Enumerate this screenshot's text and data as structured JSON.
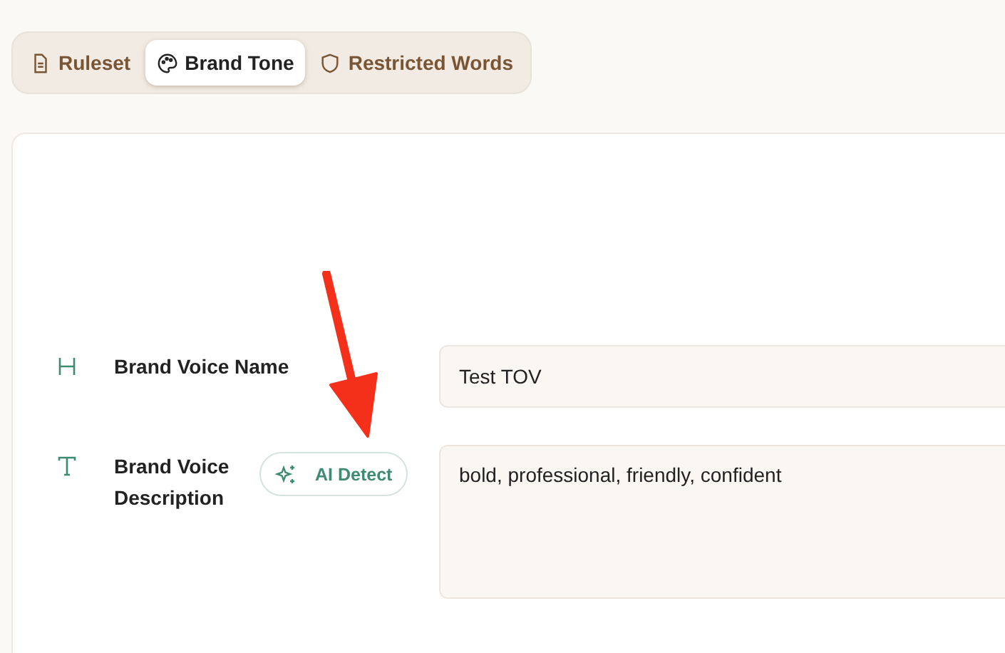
{
  "tabs": [
    {
      "label": "Ruleset",
      "kind": "document",
      "selected": false
    },
    {
      "label": "Brand Tone",
      "kind": "palette",
      "selected": true
    },
    {
      "label": "Restricted Words",
      "kind": "shield",
      "selected": false
    }
  ],
  "fields": [
    {
      "kind": "input",
      "label": "Brand Voice Name",
      "value": "Test TOV"
    },
    {
      "kind": "textarea",
      "label": "Brand Voice Description",
      "action": "AI Detect",
      "value": "bold, professional, friendly, confident"
    }
  ]
}
